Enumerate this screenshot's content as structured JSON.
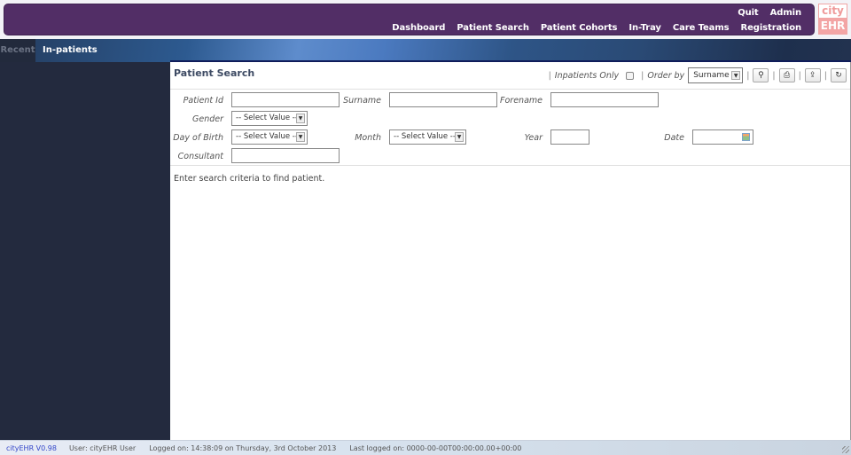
{
  "header": {
    "nav_row1": [
      "Quit",
      "Admin"
    ],
    "nav_row2": [
      "Dashboard",
      "Patient Search",
      "Patient Cohorts",
      "In-Tray",
      "Care Teams",
      "Registration"
    ],
    "logo": {
      "top": "city",
      "bottom": "EHR"
    },
    "colors": {
      "nav_bg": "#522e66",
      "logo_accent": "#f3a5a5"
    }
  },
  "tabs": [
    {
      "label": "Recent",
      "active": false
    },
    {
      "label": "In-patients",
      "active": true
    }
  ],
  "main": {
    "title": "Patient Search",
    "toolbar": {
      "inpatients_label": "Inpatients Only",
      "inpatients_checked": false,
      "order_label": "Order by",
      "order_value": "Surname",
      "buttons": [
        {
          "icon": "search-icon",
          "glyph": "⚲"
        },
        {
          "icon": "print-icon",
          "glyph": "⎙"
        },
        {
          "icon": "export-icon",
          "glyph": "⇪"
        },
        {
          "icon": "reset-icon",
          "glyph": "↻"
        }
      ]
    },
    "form": {
      "patient_id": {
        "label": "Patient Id",
        "value": ""
      },
      "surname": {
        "label": "Surname",
        "value": ""
      },
      "forename": {
        "label": "Forename",
        "value": ""
      },
      "gender": {
        "label": "Gender",
        "value": "-- Select Value --"
      },
      "day_of_birth": {
        "label": "Day of Birth",
        "value": "-- Select Value --"
      },
      "month": {
        "label": "Month",
        "value": "-- Select Value --"
      },
      "year": {
        "label": "Year",
        "value": ""
      },
      "date": {
        "label": "Date",
        "value": ""
      },
      "consultant": {
        "label": "Consultant",
        "value": ""
      }
    },
    "message": "Enter search criteria to find patient."
  },
  "footer": {
    "version": "cityEHR V0.98",
    "user": "User: cityEHR User",
    "logged_on": "Logged on: 14:38:09 on Thursday, 3rd October 2013",
    "last_logged_on": "Last logged on: 0000-00-00T00:00:00.00+00:00"
  }
}
